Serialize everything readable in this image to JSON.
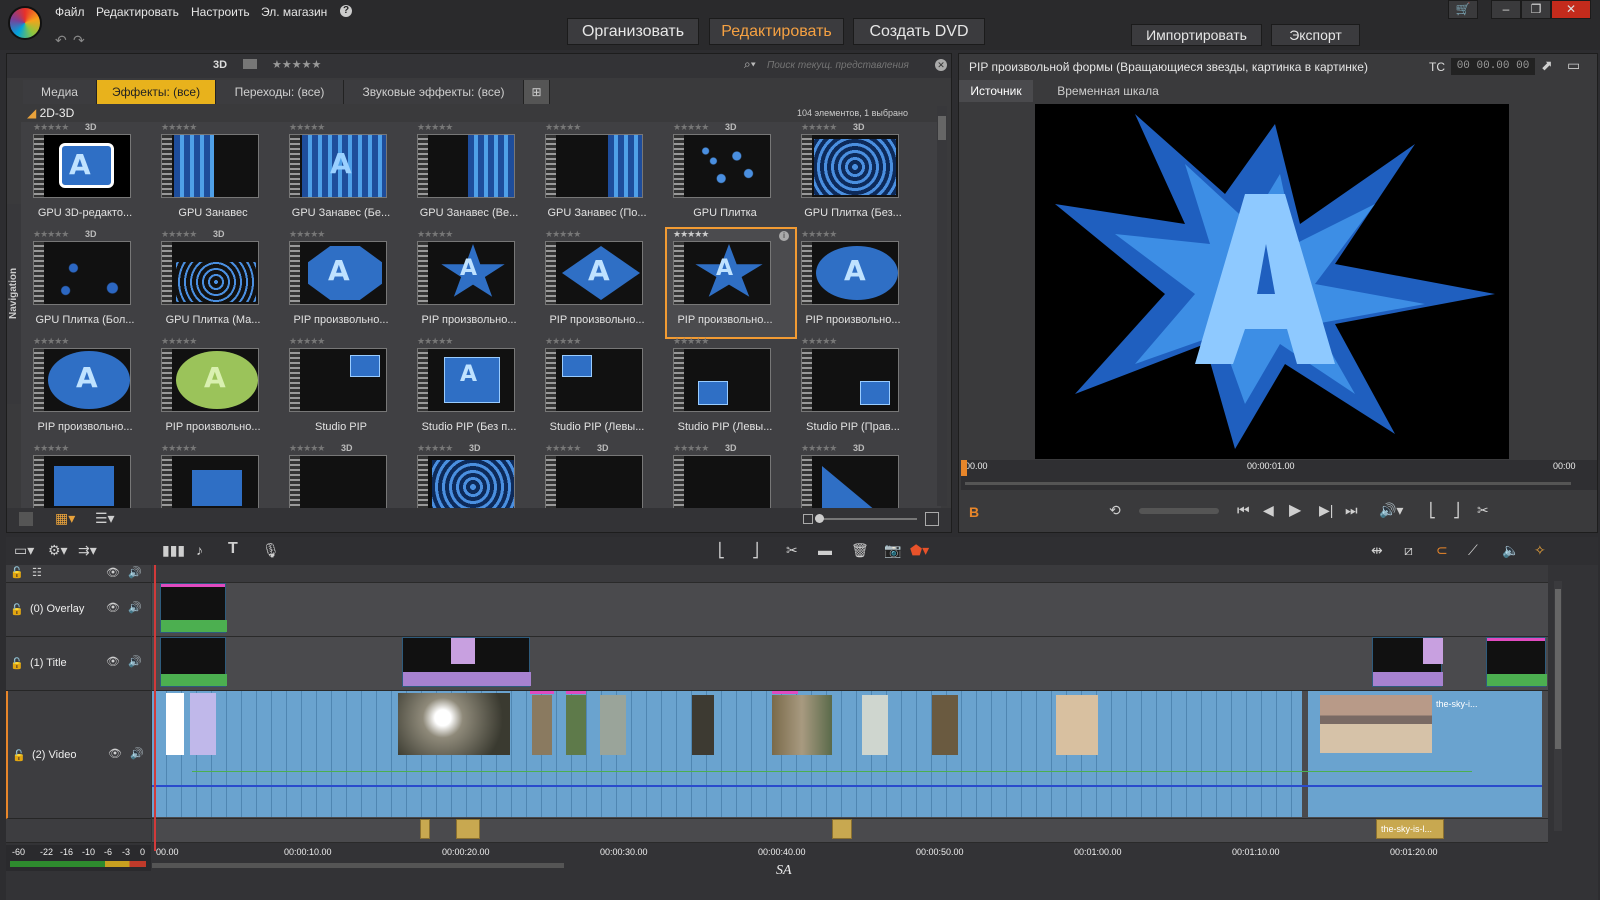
{
  "menu": {
    "file": "Файл",
    "edit": "Редактировать",
    "settings": "Настроить",
    "store": "Эл. магазин",
    "help": "?"
  },
  "modes": {
    "organize": "Организовать",
    "edit": "Редактировать",
    "dvd": "Создать DVD"
  },
  "right_buttons": {
    "import": "Импортировать",
    "export": "Экспорт"
  },
  "library": {
    "filter_3d": "3D",
    "stars": "★★★★★",
    "search_placeholder": "Поиск текущ. представления",
    "tabs": [
      "Медиа",
      "Эффекты: (все)",
      "Переходы: (все)",
      "Звуковые эффекты: (все)"
    ],
    "folder": "2D-3D",
    "count": "104 элементов, 1 выбрано",
    "nav_label": "Navigation",
    "items": [
      "GPU 3D-редакто...",
      "GPU Занавес",
      "GPU Занавес (Бе...",
      "GPU Занавес (Ве...",
      "GPU Занавес (По...",
      "GPU Плитка",
      "GPU Плитка (Без...",
      "GPU Плитка (Бол...",
      "GPU Плитка (Ма...",
      "PIP произвольно...",
      "PIP произвольно...",
      "PIP произвольно...",
      "PIP произвольно...",
      "PIP произвольно...",
      "PIP произвольно...",
      "PIP произвольно...",
      "Studio PIP",
      "Studio PIP (Без п...",
      "Studio PIP (Левы...",
      "Studio PIP (Левы...",
      "Studio PIP (Прав..."
    ],
    "badge": "3D",
    "star_small": "★★★★★"
  },
  "preview": {
    "title": "PIP произвольной формы (Вращающиеся звезды, картинка в картинке)",
    "tc_label": "TC",
    "tc_value": "00 00.00 00",
    "tabs": [
      "Источник",
      "Временная шкала"
    ],
    "t_start": "00.00",
    "t_mid": "00:00:01.00",
    "t_end": "00:00",
    "b_marker": "B"
  },
  "timeline": {
    "tracks": [
      "(0) Overlay",
      "(1) Title",
      "(2) Video"
    ],
    "ruler": [
      "00.00",
      "00:00:10.00",
      "00:00:20.00",
      "00:00:30.00",
      "00:00:40.00",
      "00:00:50.00",
      "00:01:00.00",
      "00:01:10.00",
      "00:01:20.00"
    ],
    "meter": [
      "-60",
      "-22",
      "-16",
      "-10",
      "-6",
      "-3",
      "0"
    ],
    "clip_label": "the-sky-i...",
    "audio_clip": "the-sky-is-l...",
    "watermark": "SA"
  }
}
